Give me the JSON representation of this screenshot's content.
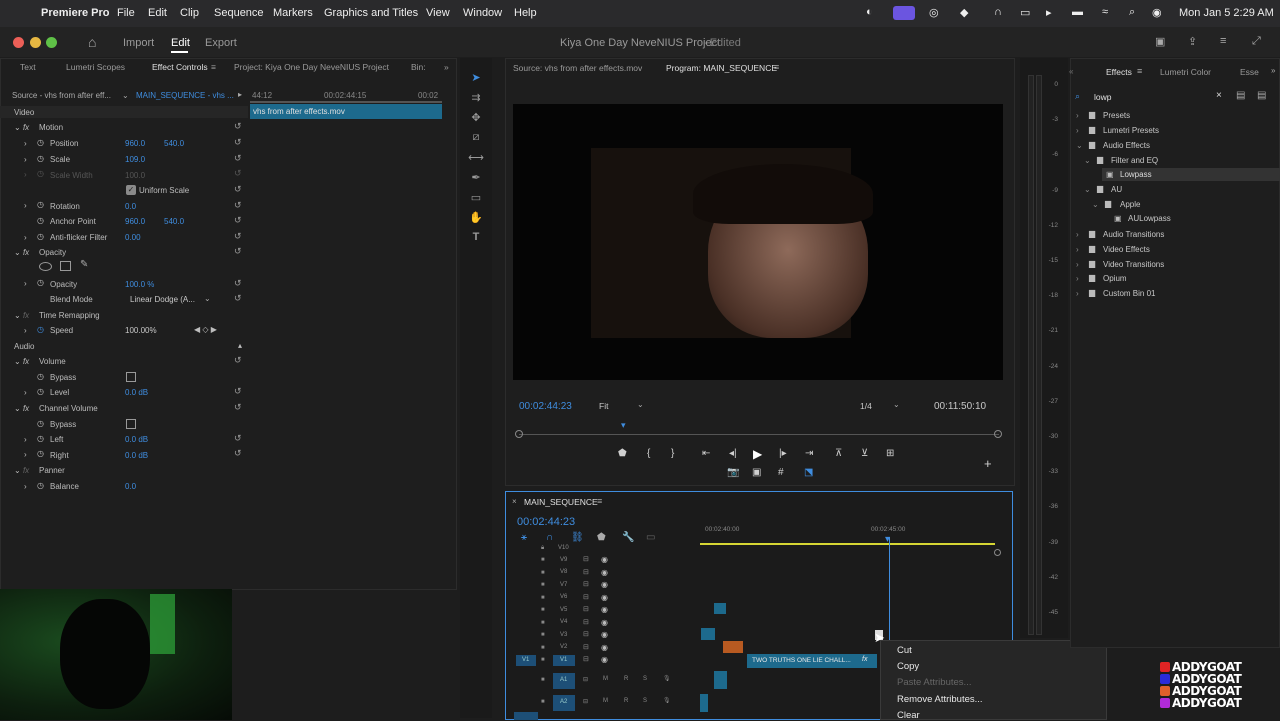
{
  "menubar": {
    "apple": "",
    "app": "Premiere Pro",
    "items": [
      "File",
      "Edit",
      "Clip",
      "Sequence",
      "Markers",
      "Graphics and Titles",
      "View",
      "Window",
      "Help"
    ],
    "clock": "Mon Jan 5  2:29 AM"
  },
  "titlebar": {
    "tabs": {
      "import": "Import",
      "edit": "Edit",
      "export": "Export"
    },
    "title": "Kiya One Day NeveNIUS Project",
    "edited": "- Edited"
  },
  "left_tabs": [
    "Text",
    "Lumetri Scopes",
    "Effect Controls",
    "Project: Kiya One Day NeveNIUS Project",
    "Bin:"
  ],
  "ec": {
    "source": "Source - vhs from after eff...",
    "sequence": "MAIN_SEQUENCE - vhs ...",
    "ruler": [
      "44:12",
      "00:02:44:15",
      "00:02"
    ],
    "clip": "vhs from after effects.mov",
    "video": "Video",
    "motion": "Motion",
    "position": "Position",
    "position_x": "960.0",
    "position_y": "540.0",
    "scale": "Scale",
    "scale_val": "109.0",
    "scale_width": "Scale Width",
    "scale_width_val": "100.0",
    "uniform": "Uniform Scale",
    "rotation": "Rotation",
    "rotation_val": "0.0",
    "anchor": "Anchor Point",
    "anchor_x": "960.0",
    "anchor_y": "540.0",
    "antiflicker": "Anti-flicker Filter",
    "antiflicker_val": "0.00",
    "opacity_group": "Opacity",
    "opacity": "Opacity",
    "opacity_val": "100.0 %",
    "blend": "Blend Mode",
    "blend_val": "Linear Dodge (A...",
    "timeremap": "Time Remapping",
    "speed": "Speed",
    "speed_val": "100.00%",
    "audio": "Audio",
    "volume": "Volume",
    "bypass": "Bypass",
    "level": "Level",
    "level_val": "0.0 dB",
    "channel": "Channel Volume",
    "bypass2": "Bypass",
    "left": "Left",
    "left_val": "0.0 dB",
    "right": "Right",
    "right_val": "0.0 dB",
    "panner": "Panner",
    "balance": "Balance",
    "balance_val": "0.0"
  },
  "monitor": {
    "source_tab": "Source: vhs from after effects.mov",
    "program_tab": "Program: MAIN_SEQUENCE",
    "timecode": "00:02:44:23",
    "fit": "Fit",
    "quality": "1/4",
    "duration": "00:11:50:10"
  },
  "timeline": {
    "name": "MAIN_SEQUENCE",
    "timecode": "00:02:44:23",
    "ruler": [
      "00:02:40:00",
      "00:02:45:00"
    ],
    "tracks": [
      "V10",
      "V9",
      "V8",
      "V7",
      "V6",
      "V5",
      "V4",
      "V3",
      "V2",
      "V1"
    ],
    "v1_src": "V1",
    "clip": "TWO TRUTHS ONE LIE CHALL...",
    "fx": "fx",
    "audio": [
      "A1",
      "A2"
    ],
    "m": "M",
    "r": "R",
    "s": "S"
  },
  "context_menu": [
    "Cut",
    "Copy",
    "Paste Attributes...",
    "Remove Attributes...",
    "Clear"
  ],
  "meter_ticks": [
    "0",
    "-3",
    "-6",
    "-9",
    "-12",
    "-15",
    "-18",
    "-21",
    "-24",
    "-27",
    "-30",
    "-33",
    "-36",
    "-39",
    "-42",
    "-45"
  ],
  "effects": {
    "tabs": [
      "Effects",
      "Lumetri Color",
      "Esse"
    ],
    "search": "lowp",
    "tree": [
      "Presets",
      "Lumetri Presets",
      "Audio Effects",
      "Filter and EQ",
      "Lowpass",
      "AU",
      "Apple",
      "AULowpass",
      "Audio Transitions",
      "Video Effects",
      "Video Transitions",
      "Opium",
      "Custom Bin 01"
    ]
  },
  "watermark": [
    "ADDYGOAT",
    "ADDYGOAT",
    "ADDYGOAT",
    "ADDYGOAT"
  ]
}
